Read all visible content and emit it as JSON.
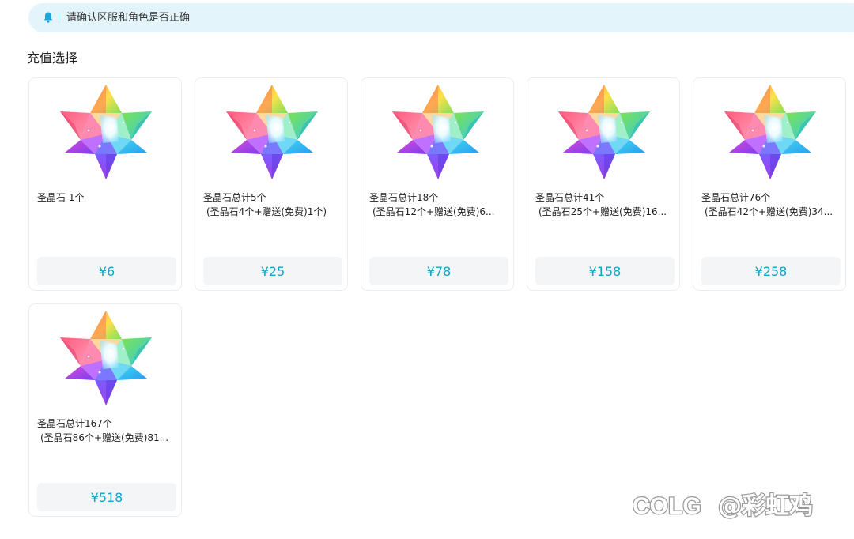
{
  "notice": {
    "icon": "bell-icon",
    "text": "请确认区服和角色是否正确",
    "background": "#e3f4fb"
  },
  "section": {
    "title": "充值选择"
  },
  "accent_color": "#13a3c8",
  "products": [
    {
      "icon": "saint-quartz-icon",
      "line1": "圣晶石 1个",
      "line2": "",
      "price": "¥6"
    },
    {
      "icon": "saint-quartz-icon",
      "line1": "圣晶石总计5个",
      "line2": "(圣晶石4个+赠送(免费)1个)",
      "price": "¥25"
    },
    {
      "icon": "saint-quartz-icon",
      "line1": "圣晶石总计18个",
      "line2": "(圣晶石12个+赠送(免费)6...",
      "price": "¥78"
    },
    {
      "icon": "saint-quartz-icon",
      "line1": "圣晶石总计41个",
      "line2": "(圣晶石25个+赠送(免费)16...",
      "price": "¥158"
    },
    {
      "icon": "saint-quartz-icon",
      "line1": "圣晶石总计76个",
      "line2": "(圣晶石42个+赠送(免费)34...",
      "price": "¥258"
    },
    {
      "icon": "saint-quartz-icon",
      "line1": "圣晶石总计167个",
      "line2": "(圣晶石86个+赠送(免费)81...",
      "price": "¥518"
    }
  ],
  "watermark": {
    "logo": "COLG",
    "handle": "@彩虹鸡"
  }
}
